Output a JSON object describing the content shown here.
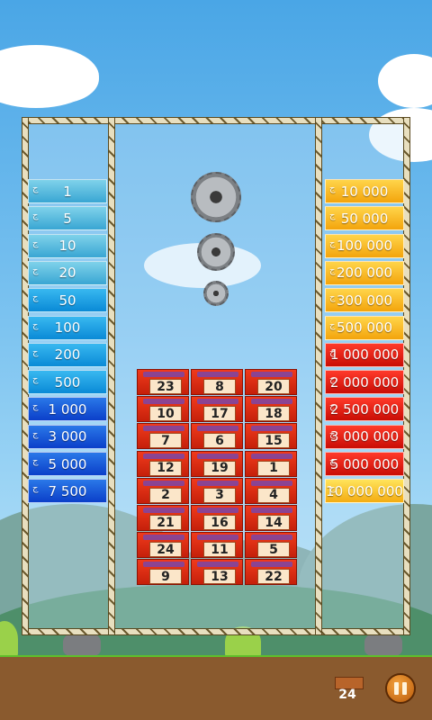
{
  "currency_symbol": "ج",
  "left_prizes": [
    {
      "label": "1",
      "tier": "p-l1"
    },
    {
      "label": "5",
      "tier": "p-l1"
    },
    {
      "label": "10",
      "tier": "p-l1"
    },
    {
      "label": "20",
      "tier": "p-l1"
    },
    {
      "label": "50",
      "tier": "p-l2"
    },
    {
      "label": "100",
      "tier": "p-l2"
    },
    {
      "label": "200",
      "tier": "p-l2"
    },
    {
      "label": "500",
      "tier": "p-l2"
    },
    {
      "label": "1 000",
      "tier": "p-l3"
    },
    {
      "label": "3 000",
      "tier": "p-l3"
    },
    {
      "label": "5 000",
      "tier": "p-l3"
    },
    {
      "label": "7 500",
      "tier": "p-l3"
    }
  ],
  "right_prizes": [
    {
      "label": "10 000",
      "tier": "p-gold"
    },
    {
      "label": "50 000",
      "tier": "p-gold"
    },
    {
      "label": "100 000",
      "tier": "p-gold"
    },
    {
      "label": "200 000",
      "tier": "p-gold"
    },
    {
      "label": "300 000",
      "tier": "p-gold"
    },
    {
      "label": "500 000",
      "tier": "p-gold"
    },
    {
      "label": "1 000 000",
      "tier": "p-red"
    },
    {
      "label": "2 000 000",
      "tier": "p-red"
    },
    {
      "label": "2 500 000",
      "tier": "p-red"
    },
    {
      "label": "3 000 000",
      "tier": "p-red"
    },
    {
      "label": "5 000 000",
      "tier": "p-red"
    },
    {
      "label": "10 000 000",
      "tier": "p-green"
    }
  ],
  "boxes": [
    [
      "23",
      "8",
      "20"
    ],
    [
      "10",
      "17",
      "18"
    ],
    [
      "7",
      "6",
      "15"
    ],
    [
      "12",
      "19",
      "1"
    ],
    [
      "2",
      "3",
      "4"
    ],
    [
      "21",
      "16",
      "14"
    ],
    [
      "24",
      "11",
      "5"
    ],
    [
      "9",
      "13",
      "22"
    ]
  ],
  "boxes_remaining": "24",
  "icons": {
    "saw": "circular-saw-icon",
    "pause": "pause-icon",
    "crate": "crate-icon"
  }
}
